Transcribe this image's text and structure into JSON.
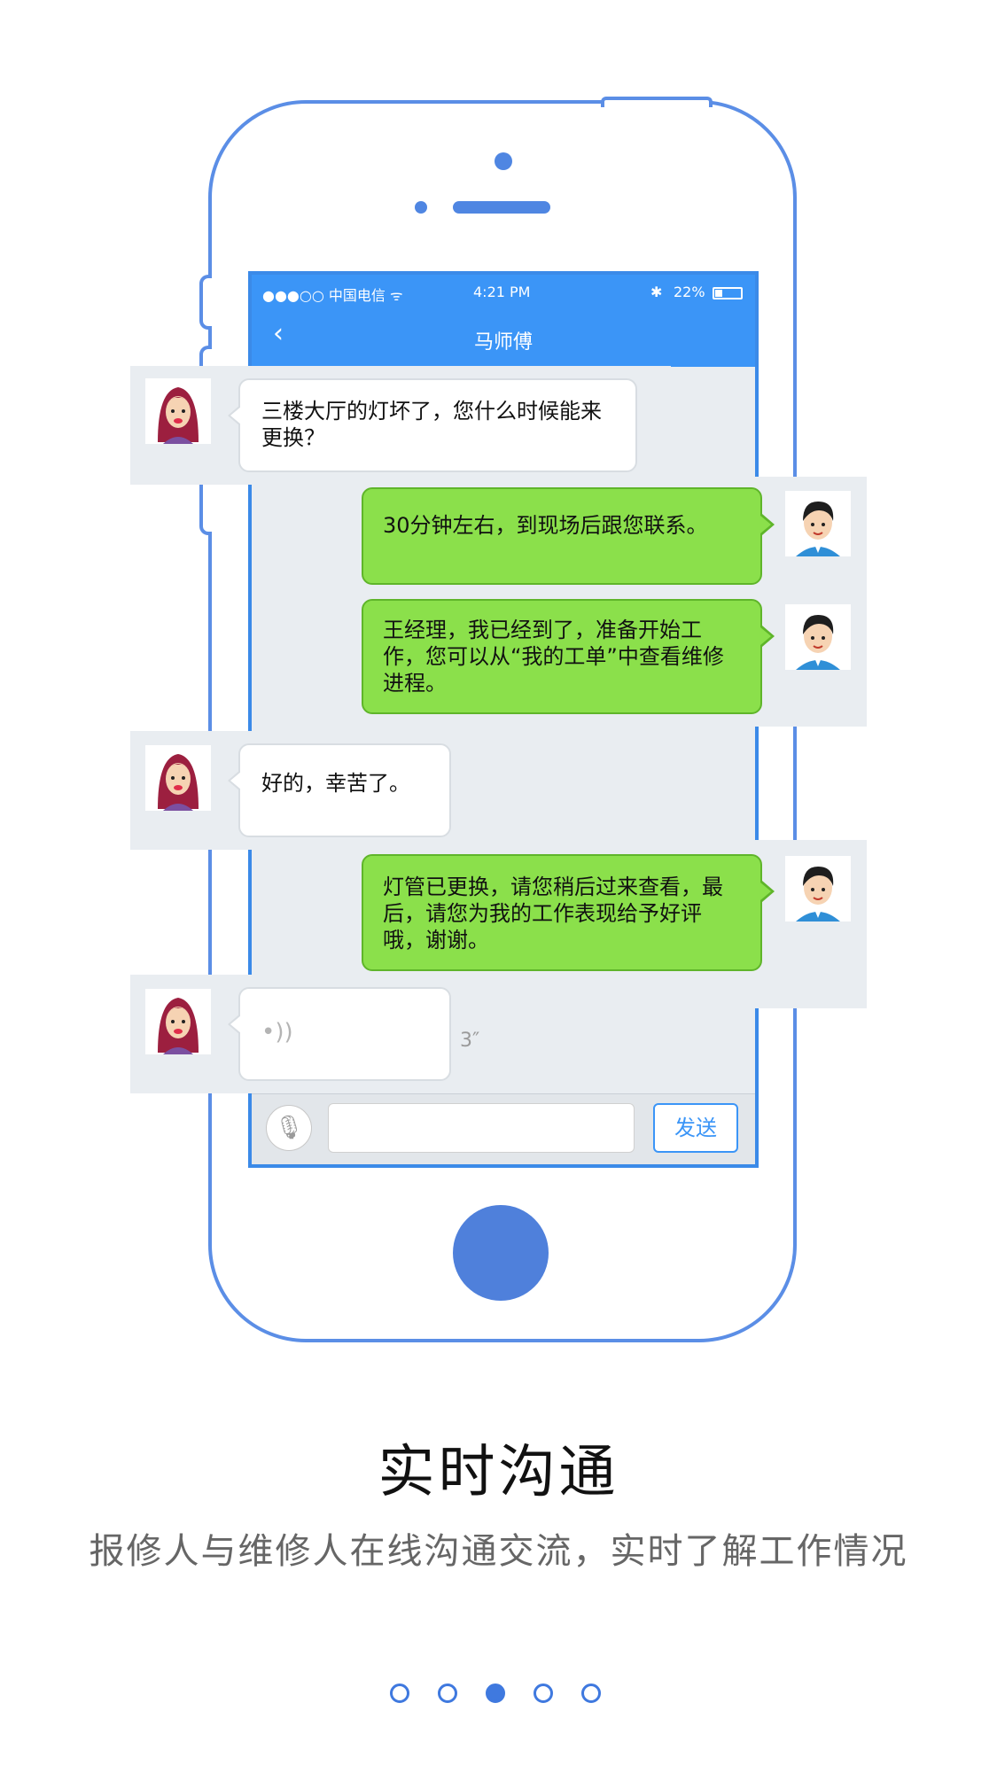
{
  "status_bar": {
    "carrier": "●●●○○ 中国电信 ᯤ",
    "time": "4:21 PM",
    "bt": "✱",
    "battery": "22%"
  },
  "nav": {
    "back_glyph": "‹",
    "title": "马师傅"
  },
  "messages": [
    {
      "side": "left",
      "text": "三楼大厅的灯坏了，您什么时候能来更换？"
    },
    {
      "side": "right",
      "text": "30分钟左右，到现场后跟您联系。"
    },
    {
      "side": "right",
      "text": "王经理，我已经到了，准备开始工作，您可以从“我的工单”中查看维修进程。"
    },
    {
      "side": "left",
      "text": "好的，幸苦了。"
    },
    {
      "side": "right",
      "text": "灯管已更换，请您稍后过来查看，最后，请您为我的工作表现给予好评哦，谢谢。"
    },
    {
      "side": "left",
      "type": "voice",
      "icon": "•))",
      "duration": "3″"
    }
  ],
  "input_bar": {
    "mic_glyph": "🎙",
    "send_label": "发送"
  },
  "caption": {
    "title": "实时沟通",
    "subtitle": "报修人与维修人在线沟通交流，实时了解工作情况"
  },
  "pager": {
    "count": 5,
    "active_index": 2
  },
  "colors": {
    "accent": "#3b95f7",
    "outline": "#5b8ee6",
    "bubble_green": "#8be04b"
  }
}
